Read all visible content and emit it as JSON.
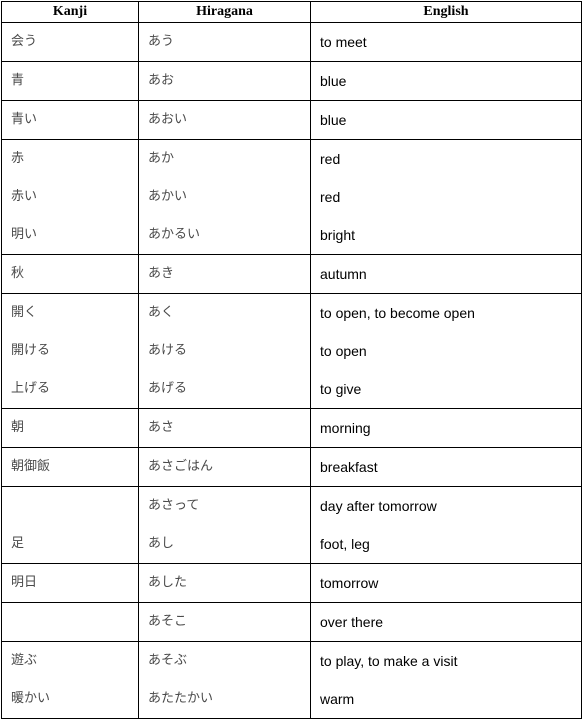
{
  "headers": {
    "kanji": "Kanji",
    "hiragana": "Hiragana",
    "english": "English"
  },
  "rows": [
    {
      "lines": [
        {
          "kanji": "会う",
          "hiragana": "あう",
          "english": "to meet"
        }
      ]
    },
    {
      "lines": [
        {
          "kanji": "青",
          "hiragana": "あお",
          "english": "blue"
        }
      ]
    },
    {
      "lines": [
        {
          "kanji": "青い",
          "hiragana": "あおい",
          "english": "blue"
        }
      ]
    },
    {
      "lines": [
        {
          "kanji": "赤",
          "hiragana": "あか",
          "english": "red"
        },
        {
          "kanji": "赤い",
          "hiragana": "あかい",
          "english": "red"
        },
        {
          "kanji": "明い",
          "hiragana": "あかるい",
          "english": "bright"
        }
      ]
    },
    {
      "lines": [
        {
          "kanji": "秋",
          "hiragana": "あき",
          "english": "autumn"
        }
      ]
    },
    {
      "lines": [
        {
          "kanji": "開く",
          "hiragana": "あく",
          "english": "to open, to become open"
        },
        {
          "kanji": "開ける",
          "hiragana": "あける",
          "english": "to open"
        },
        {
          "kanji": "上げる",
          "hiragana": "あげる",
          "english": "to give"
        }
      ]
    },
    {
      "lines": [
        {
          "kanji": "朝",
          "hiragana": "あさ",
          "english": "morning"
        }
      ]
    },
    {
      "lines": [
        {
          "kanji": "朝御飯",
          "hiragana": "あさごはん",
          "english": "breakfast"
        }
      ]
    },
    {
      "lines": [
        {
          "kanji": "",
          "hiragana": "あさって",
          "english": "day after tomorrow"
        },
        {
          "kanji": "足",
          "hiragana": "あし",
          "english": "foot, leg"
        }
      ]
    },
    {
      "lines": [
        {
          "kanji": "明日",
          "hiragana": "あした",
          "english": "tomorrow"
        }
      ]
    },
    {
      "lines": [
        {
          "kanji": "",
          "hiragana": "あそこ",
          "english": "over there"
        }
      ]
    },
    {
      "lines": [
        {
          "kanji": "遊ぶ",
          "hiragana": "あそぶ",
          "english": "to play, to make a visit"
        },
        {
          "kanji": "暖かい",
          "hiragana": "あたたかい",
          "english": "warm"
        }
      ]
    }
  ]
}
